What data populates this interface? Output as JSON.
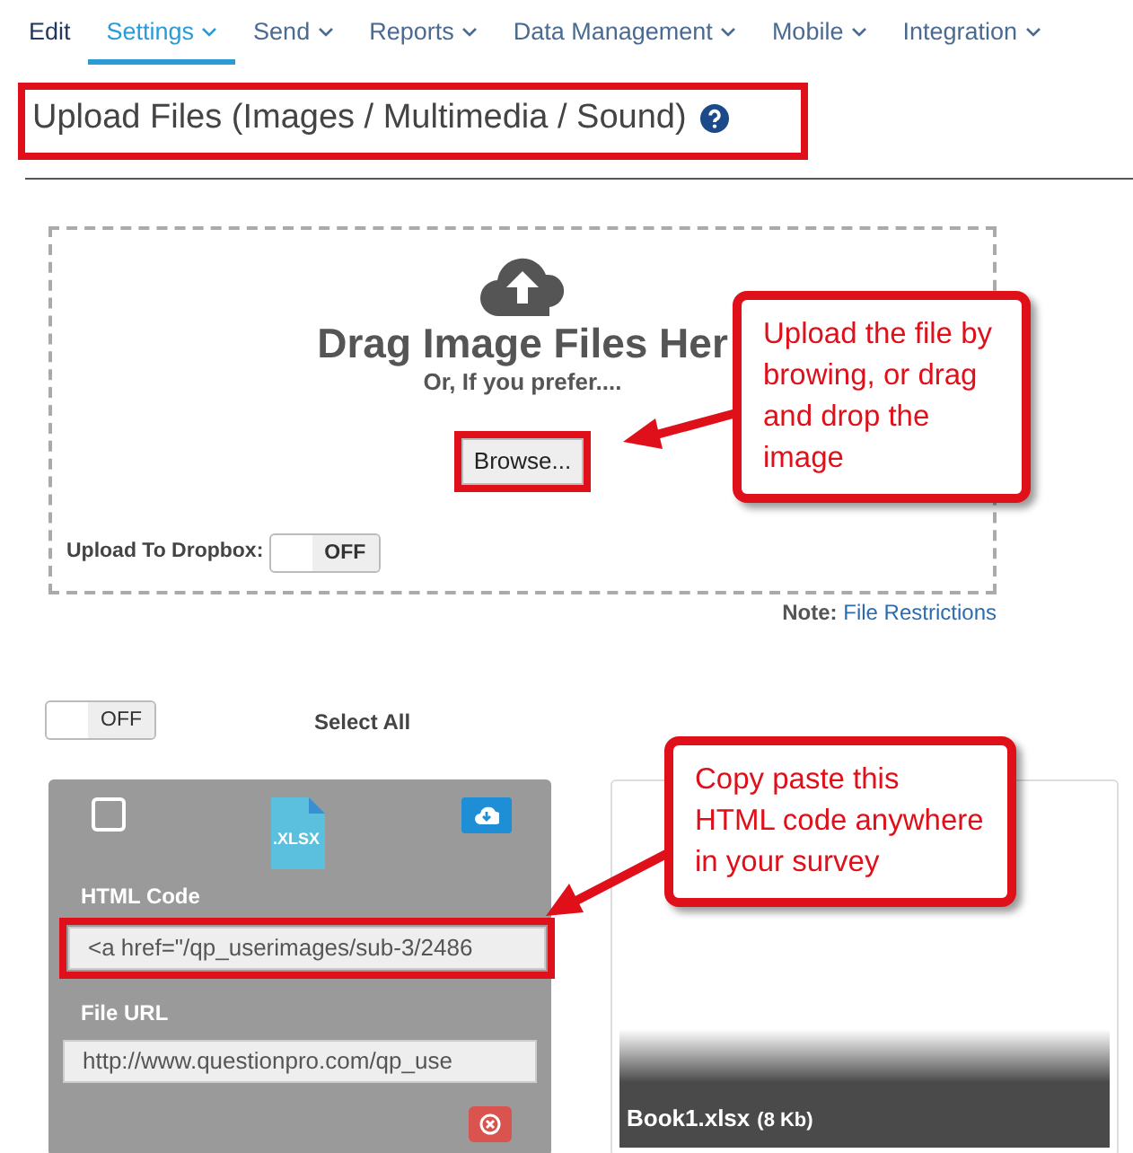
{
  "nav": [
    {
      "label": "Edit",
      "selected": false,
      "dropdown": false
    },
    {
      "label": "Settings",
      "selected": true,
      "dropdown": true
    },
    {
      "label": "Send",
      "selected": false,
      "dropdown": true
    },
    {
      "label": "Reports",
      "selected": false,
      "dropdown": true
    },
    {
      "label": "Data Management",
      "selected": false,
      "dropdown": true
    },
    {
      "label": "Mobile",
      "selected": false,
      "dropdown": true
    },
    {
      "label": "Integration",
      "selected": false,
      "dropdown": true
    }
  ],
  "page_title": "Upload Files (Images / Multimedia / Sound)",
  "dropzone": {
    "heading": "Drag Image Files Her",
    "subheading": "Or, If you prefer....",
    "browse_button": "Browse...",
    "dropbox": {
      "label": "Upload To Dropbox:",
      "on": false,
      "state_text": "OFF"
    },
    "note_label": "Note:",
    "note_link": "File Restrictions"
  },
  "select_all": {
    "on": false,
    "state_text": "OFF",
    "label": "Select All"
  },
  "files": [
    {
      "checked": false,
      "file_type": ".XLSX",
      "html_code_label": "HTML Code",
      "html_code": "<a href=\"/qp_userimages/sub-3/2486",
      "file_url_label": "File URL",
      "file_url": "http://www.questionpro.com/qp_use"
    }
  ],
  "preview": {
    "file_name": "Book1.xlsx",
    "file_size": "(8 Kb)"
  },
  "callouts": [
    {
      "text": "Upload the file by browing, or drag and drop the image"
    },
    {
      "text": "Copy paste this HTML code anywhere in your survey"
    }
  ]
}
